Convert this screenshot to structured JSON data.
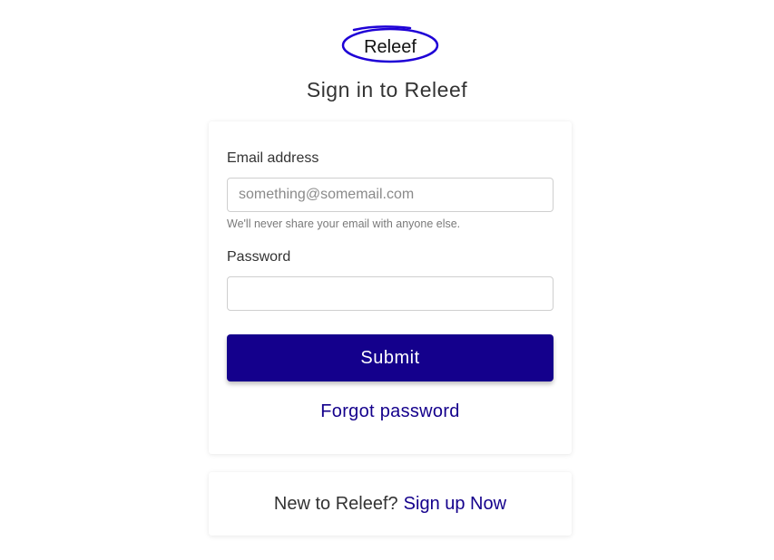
{
  "brand": {
    "logo_text": "Releef",
    "accent_color": "#14008c",
    "logo_ring_color": "#1e00d6"
  },
  "header": {
    "title": "Sign in to Releef"
  },
  "login_form": {
    "email_label": "Email address",
    "email_placeholder": "something@somemail.com",
    "email_value": "",
    "email_help": "We'll never share your email with anyone else.",
    "password_label": "Password",
    "password_value": "",
    "submit_label": "Submit",
    "forgot_label": "Forgot password"
  },
  "signup": {
    "prefix": "New to Releef?",
    "link_label": "Sign up Now"
  }
}
